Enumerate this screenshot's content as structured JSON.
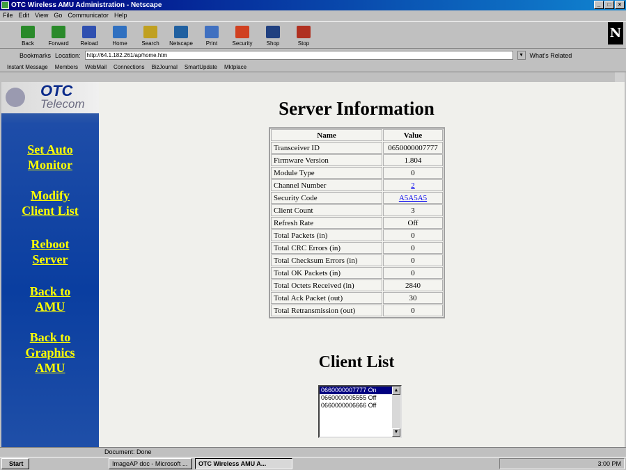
{
  "window": {
    "title": "OTC Wireless AMU Administration - Netscape"
  },
  "menu": [
    "File",
    "Edit",
    "View",
    "Go",
    "Communicator",
    "Help"
  ],
  "toolbar": [
    {
      "label": "Back",
      "icon": "back-arrow-icon",
      "color": "#2a8a2a"
    },
    {
      "label": "Forward",
      "icon": "forward-arrow-icon",
      "color": "#2a8a2a"
    },
    {
      "label": "Reload",
      "icon": "reload-icon",
      "color": "#3050b0"
    },
    {
      "label": "Home",
      "icon": "home-icon",
      "color": "#3070c0"
    },
    {
      "label": "Search",
      "icon": "search-icon",
      "color": "#c0a020"
    },
    {
      "label": "Netscape",
      "icon": "netscape-icon",
      "color": "#2060a0"
    },
    {
      "label": "Print",
      "icon": "print-icon",
      "color": "#4070c0"
    },
    {
      "label": "Security",
      "icon": "security-icon",
      "color": "#d04020"
    },
    {
      "label": "Shop",
      "icon": "shop-icon",
      "color": "#204080"
    },
    {
      "label": "Stop",
      "icon": "stop-icon",
      "color": "#b03020"
    }
  ],
  "location": {
    "bookmarks_label": "Bookmarks",
    "location_label": "Location:",
    "url": "http://64.1.182.261/ap/home.htm",
    "related_label": "What's Related"
  },
  "links_bar": [
    "Instant Message",
    "Members",
    "WebMail",
    "Connections",
    "BizJournal",
    "SmartUpdate",
    "Mktplace"
  ],
  "sidebar": {
    "logo_line1": "OTC",
    "logo_line2": "Telecom",
    "links": [
      {
        "line1": "Set Auto",
        "line2": "Monitor"
      },
      {
        "line1": "Modify",
        "line2": "Client List"
      },
      {
        "line1": "Reboot",
        "line2": "Server"
      },
      {
        "line1": "Back to",
        "line2": "AMU"
      },
      {
        "line1": "Back to",
        "line2": "Graphics",
        "line3": "AMU"
      }
    ]
  },
  "main": {
    "title": "Server Information",
    "table_headers": {
      "name": "Name",
      "value": "Value"
    },
    "rows": [
      {
        "name": "Transceiver ID",
        "value": "0650000007777",
        "link": false
      },
      {
        "name": "Firmware Version",
        "value": "1.804",
        "link": false
      },
      {
        "name": "Module Type",
        "value": "0",
        "link": false
      },
      {
        "name": "Channel Number",
        "value": "2",
        "link": true
      },
      {
        "name": "Security Code",
        "value": "A5A5A5",
        "link": true
      },
      {
        "name": "Client Count",
        "value": "3",
        "link": false
      },
      {
        "name": "Refresh Rate",
        "value": "Off",
        "link": false
      },
      {
        "name": "Total Packets (in)",
        "value": "0",
        "link": false
      },
      {
        "name": "Total CRC Errors (in)",
        "value": "0",
        "link": false
      },
      {
        "name": "Total Checksum Errors (in)",
        "value": "0",
        "link": false
      },
      {
        "name": "Total OK Packets (in)",
        "value": "0",
        "link": false
      },
      {
        "name": "Total Octets Received (in)",
        "value": "2840",
        "link": false
      },
      {
        "name": "Total Ack Packet (out)",
        "value": "30",
        "link": false
      },
      {
        "name": "Total Retransmission (out)",
        "value": "0",
        "link": false
      }
    ],
    "client_title": "Client List",
    "clients": [
      {
        "text": "0660000007777 On",
        "selected": true
      },
      {
        "text": "0660000005555 Off",
        "selected": false
      },
      {
        "text": "0660000006666 Off",
        "selected": false
      }
    ]
  },
  "status": {
    "text": "Document: Done"
  },
  "taskbar": {
    "start": "Start",
    "items": [
      {
        "label": "ImageAP doc - Microsoft ...",
        "active": false
      },
      {
        "label": "OTC Wireless AMU A...",
        "active": true
      }
    ],
    "clock": "3:00 PM"
  }
}
